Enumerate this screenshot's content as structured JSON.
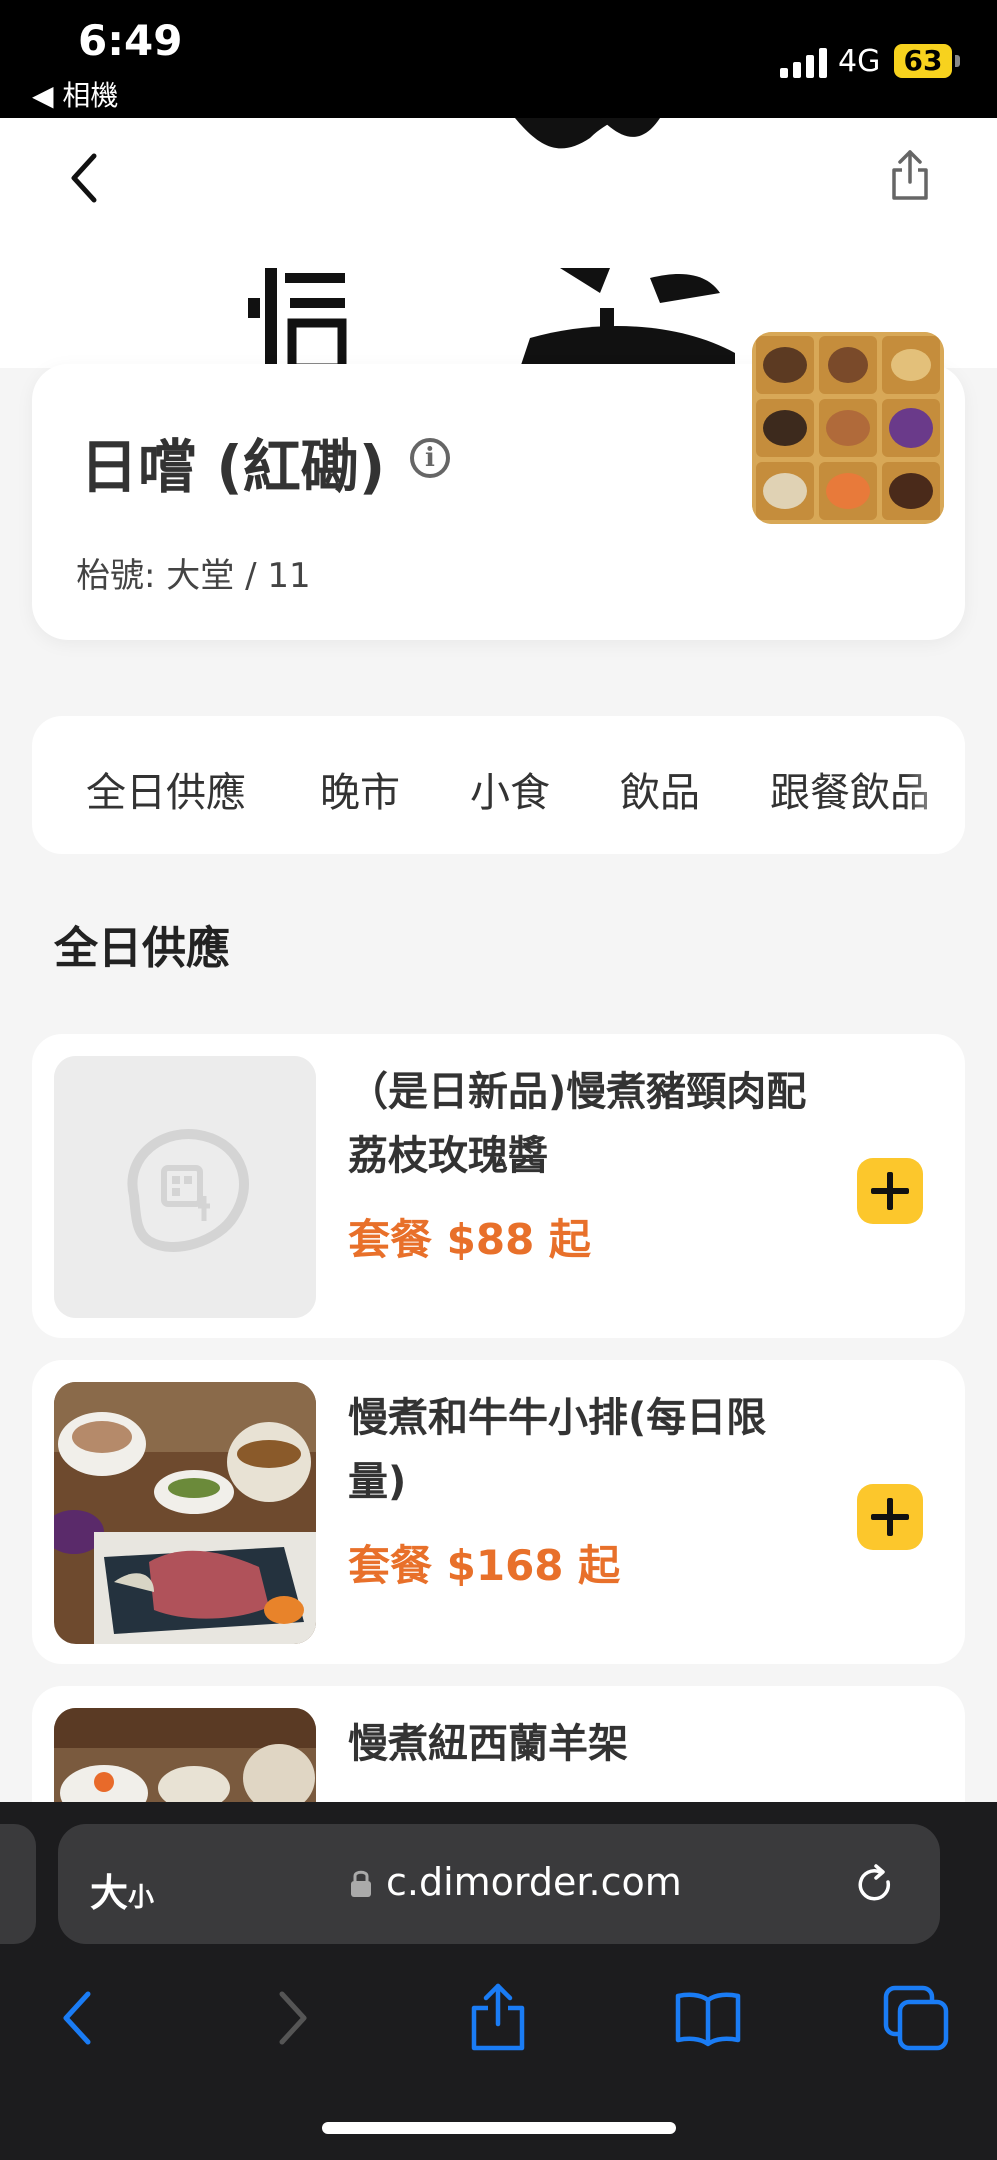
{
  "status_bar": {
    "time": "6:49",
    "back_app": "◀ 相機",
    "network": "4G",
    "battery": "63"
  },
  "store": {
    "name": "日嚐 (紅磡)",
    "table_label": "枱號: 大堂 / 11"
  },
  "tabs": [
    "全日供應",
    "晚市",
    "小食",
    "飲品",
    "跟餐飲品"
  ],
  "section_title": "全日供應",
  "menu_items": [
    {
      "name": "（是日新品)慢煮豬頸肉配荔枝玫瑰醬",
      "price": "套餐  $88  起"
    },
    {
      "name": "慢煮和牛牛小排(每日限量)",
      "price": "套餐  $168  起"
    },
    {
      "name": "慢煮紐西蘭羊架",
      "price": ""
    }
  ],
  "browser": {
    "text_size_label": "大",
    "text_size_small": "小",
    "url": "c.dimorder.com"
  },
  "colors": {
    "accent": "#fcc72c",
    "price": "#e8702a",
    "browser_tint": "#1a7cf5"
  }
}
